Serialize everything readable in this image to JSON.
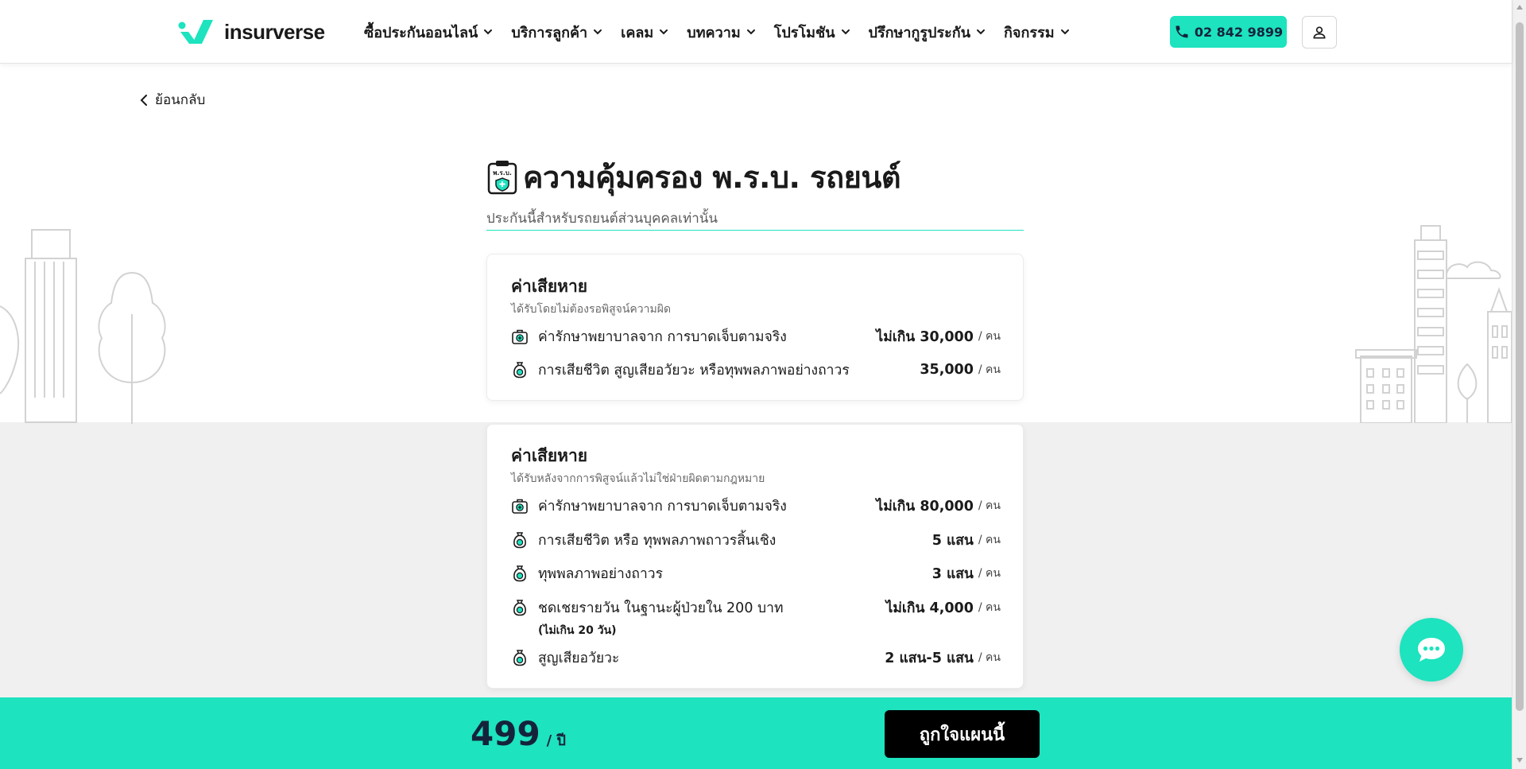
{
  "header": {
    "logo_text": "insurverse",
    "nav": [
      {
        "label": "ซื้อประกันออนไลน์"
      },
      {
        "label": "บริการลูกค้า"
      },
      {
        "label": "เคลม"
      },
      {
        "label": "บทความ"
      },
      {
        "label": "โปรโมชัน"
      },
      {
        "label": "ปรึกษากูรูประกัน"
      },
      {
        "label": "กิจกรรม"
      }
    ],
    "phone": "02 842 9899"
  },
  "back_label": "ย้อนกลับ",
  "page": {
    "badge_text": "พ.ร.บ.",
    "title": "ความคุ้มครอง พ.ร.บ. รถยนต์",
    "subtitle": "ประกันนี้สำหรับรถยนต์ส่วนบุคคลเท่านั้น"
  },
  "cards": [
    {
      "title": "ค่าเสียหาย",
      "subtitle": "ได้รับโดยไม่ต้องรอพิสูจน์ความผิด",
      "rows": [
        {
          "icon": "medical-bag-icon",
          "label": "ค่ารักษาพยาบาลจาก การบาดเจ็บตามจริง",
          "value": "ไม่เกิน 30,000",
          "unit": "/ คน"
        },
        {
          "icon": "money-bag-icon",
          "label": "การเสียชีวิต สูญเสียอวัยวะ หรือทุพพลภาพอย่างถาวร",
          "value": "35,000",
          "unit": "/ คน"
        }
      ]
    },
    {
      "title": "ค่าเสียหาย",
      "subtitle": "ได้รับหลังจากการพิสูจน์แล้วไม่ใช่ฝ่ายผิดตามกฎหมาย",
      "rows": [
        {
          "icon": "medical-bag-icon",
          "label": "ค่ารักษาพยาบาลจาก การบาดเจ็บตามจริง",
          "value": "ไม่เกิน 80,000",
          "unit": "/ คน"
        },
        {
          "icon": "money-bag-icon",
          "label": "การเสียชีวิต หรือ ทุพพลภาพถาวรสิ้นเชิง",
          "value": "5 แสน",
          "unit": "/ คน"
        },
        {
          "icon": "money-bag-icon",
          "label": "ทุพพลภาพอย่างถาวร",
          "value": "3 แสน",
          "unit": "/ คน"
        },
        {
          "icon": "money-bag-icon",
          "label": "ชดเชยรายวัน ในฐานะผู้ป่วยใน 200 บาท",
          "note": "(ไม่เกิน 20 วัน)",
          "value": "ไม่เกิน 4,000",
          "unit": "/ คน"
        },
        {
          "icon": "money-bag-icon",
          "label": "สูญเสียอวัยวะ",
          "value": "2 แสน-5 แสน",
          "unit": "/ คน"
        }
      ]
    }
  ],
  "footer": {
    "price": "499",
    "price_unit": "/ ปี",
    "cta_label": "ถูกใจแผนนี้"
  },
  "colors": {
    "accent": "#1de3bf",
    "dark": "#15233a",
    "grey_band": "#f0f0f0"
  }
}
